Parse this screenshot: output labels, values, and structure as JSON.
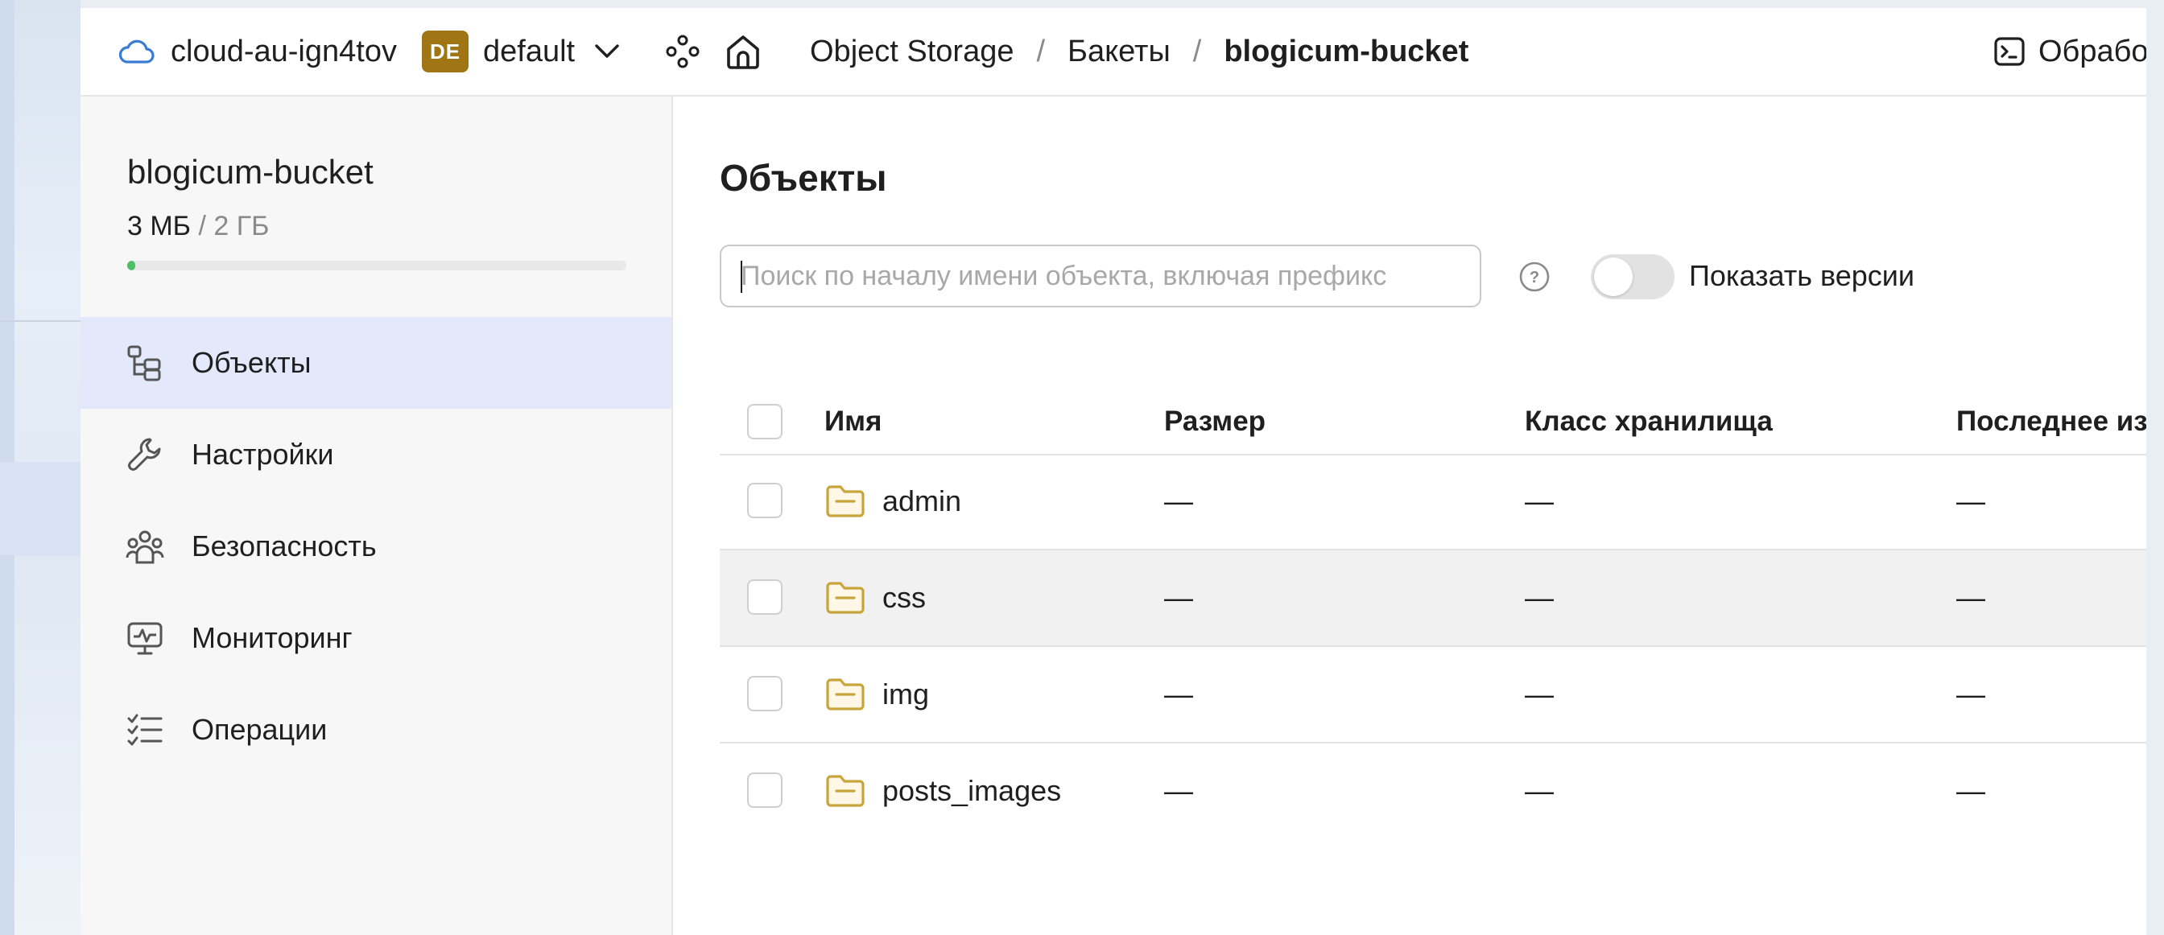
{
  "header": {
    "cloud_name": "cloud-au-ign4tov",
    "folder_badge": "DE",
    "folder_name": "default",
    "breadcrumbs": [
      "Object Storage",
      "Бакеты",
      "blogicum-bucket"
    ],
    "separator": "/",
    "right_action": "Обрабо"
  },
  "sidebar": {
    "bucket_name": "blogicum-bucket",
    "usage_used": "3 МБ",
    "usage_sep": " / ",
    "usage_total": "2 ГБ",
    "usage_fraction": 0.0015,
    "items": [
      {
        "label": "Объекты",
        "icon": "objects-tree-icon",
        "active": true
      },
      {
        "label": "Настройки",
        "icon": "wrench-icon",
        "active": false
      },
      {
        "label": "Безопасность",
        "icon": "users-icon",
        "active": false
      },
      {
        "label": "Мониторинг",
        "icon": "monitor-icon",
        "active": false
      },
      {
        "label": "Операции",
        "icon": "checklist-icon",
        "active": false
      }
    ]
  },
  "main": {
    "title": "Объекты",
    "search_placeholder": "Поиск по началу имени объекта, включая префикс",
    "show_versions_label": "Показать версии",
    "show_versions_on": false,
    "columns": [
      "Имя",
      "Размер",
      "Класс хранилища",
      "Последнее из"
    ],
    "rows": [
      {
        "name": "admin",
        "size": "—",
        "class": "—",
        "modified": "—"
      },
      {
        "name": "css",
        "size": "—",
        "class": "—",
        "modified": "—"
      },
      {
        "name": "img",
        "size": "—",
        "class": "—",
        "modified": "—"
      },
      {
        "name": "posts_images",
        "size": "—",
        "class": "—",
        "modified": "—"
      }
    ]
  },
  "colors": {
    "accent_active": "#e3e8fb",
    "folder": "#c9a43b",
    "badge": "#a07514",
    "usage_fill": "#4cbf63"
  }
}
